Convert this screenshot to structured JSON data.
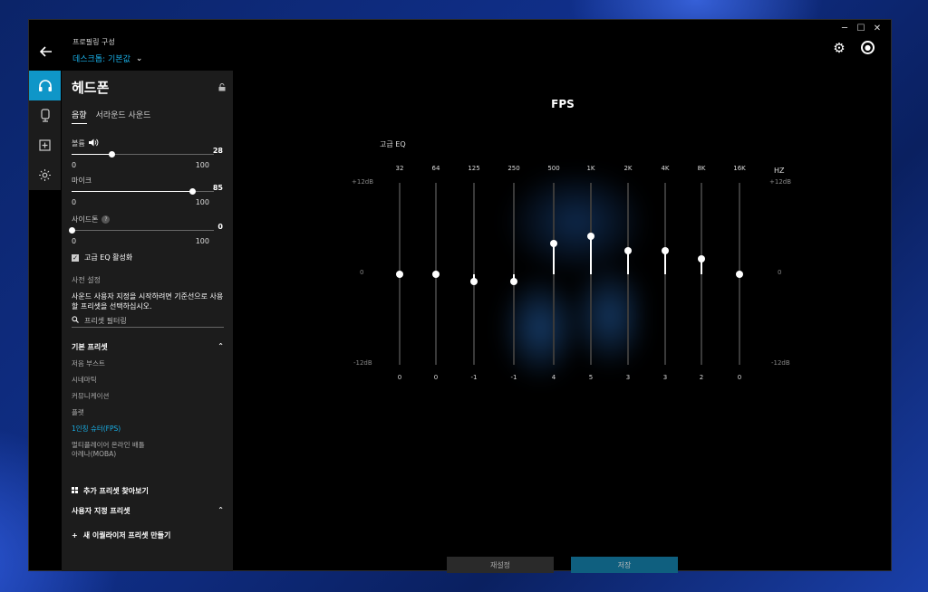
{
  "window_controls": {
    "minimize": "─",
    "maximize": "☐",
    "close": "✕"
  },
  "header": {
    "profile_label": "프로필링 구성",
    "profile_value": "데스크톱: 기본값"
  },
  "panel": {
    "title": "헤드폰",
    "tabs": [
      "음향",
      "서라운드 사운드"
    ],
    "volume": {
      "label": "볼륨",
      "value": "28",
      "min": "0",
      "max": "100",
      "fraction": 0.28
    },
    "mic": {
      "label": "마이크",
      "value": "85",
      "min": "0",
      "max": "100",
      "fraction": 0.85
    },
    "sidetone": {
      "label": "사이드톤",
      "help": "?",
      "value": "0",
      "min": "0",
      "max": "100",
      "fraction": 0.0
    },
    "advanced_eq_label": "고급 EQ 활성화",
    "preset_heading": "사전 설정",
    "preset_desc": "사운드 사용자 지정을 시작하려면 기준선으로 사용할 프리셋을 선택하십시오.",
    "filter_placeholder": "프리셋 필터링",
    "default_presets_heading": "기본 프리셋",
    "presets": [
      "저음 부스트",
      "시네마틱",
      "커뮤니케이션",
      "플랫",
      "1인칭 슈터(FPS)",
      "멀티플레이어 온라인 배틀",
      "아레나(MOBA)"
    ],
    "active_preset_index": 4,
    "browse_more_label": "추가 프리셋 찾아보기",
    "custom_presets_heading": "사용자 지정 프리셋",
    "new_eq_label": "새 이퀄라이저 프리셋 만들기"
  },
  "main": {
    "preset_title": "FPS",
    "eq_title": "고급 EQ",
    "db_top": "+12dB",
    "db_mid": "0",
    "db_bottom": "-12dB",
    "hz": "HZ",
    "bands": [
      {
        "freq": "32",
        "value": 0
      },
      {
        "freq": "64",
        "value": 0
      },
      {
        "freq": "125",
        "value": -1
      },
      {
        "freq": "250",
        "value": -1
      },
      {
        "freq": "500",
        "value": 4
      },
      {
        "freq": "1K",
        "value": 5
      },
      {
        "freq": "2K",
        "value": 3
      },
      {
        "freq": "4K",
        "value": 3
      },
      {
        "freq": "8K",
        "value": 2
      },
      {
        "freq": "16K",
        "value": 0
      }
    ],
    "reset_label": "재설정",
    "save_label": "저장"
  },
  "colors": {
    "accent": "#0f96c8",
    "active_text": "#19b0e8",
    "save_button": "#0f5f7f"
  }
}
